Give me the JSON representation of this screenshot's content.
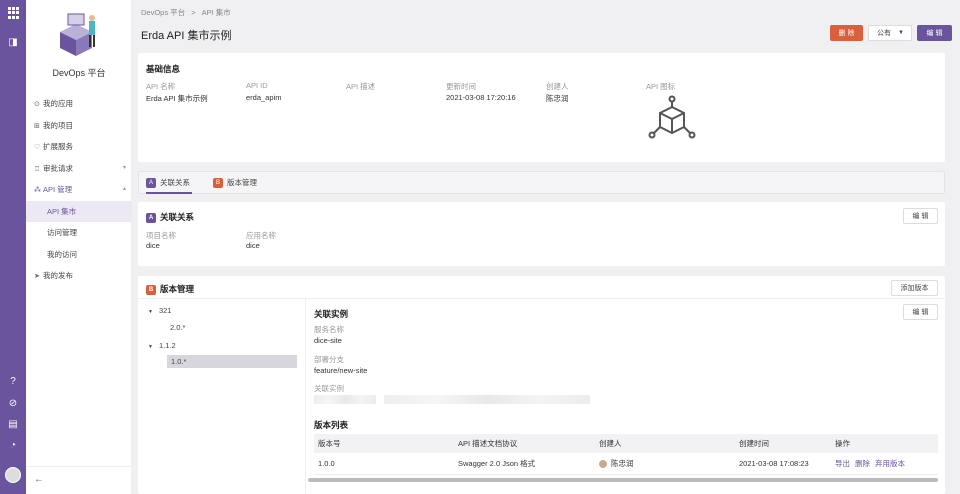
{
  "sidebar": {
    "brand": "DevOps 平台",
    "items": [
      {
        "label": "我的应用",
        "icon": "app-icon"
      },
      {
        "label": "我的项目",
        "icon": "project-icon"
      },
      {
        "label": "扩展服务",
        "icon": "heart-icon"
      },
      {
        "label": "审批请求",
        "icon": "approval-icon"
      },
      {
        "label": "API 管理",
        "icon": "api-icon"
      },
      {
        "label": "API 集市"
      },
      {
        "label": "访问管理"
      },
      {
        "label": "我的访问"
      },
      {
        "label": "我的发布",
        "icon": "send-icon"
      }
    ]
  },
  "breadcrumb": {
    "root": "DevOps 平台",
    "sep": ">",
    "current": "API 集市"
  },
  "page": {
    "title": "Erda API 集市示例"
  },
  "actions": {
    "delete": "删 除",
    "visibility": "公有",
    "edit": "编 辑"
  },
  "basic": {
    "heading": "基础信息",
    "fields": [
      {
        "label": "API 名称",
        "value": "Erda API 集市示例"
      },
      {
        "label": "API ID",
        "value": "erda_apim"
      },
      {
        "label": "API 描述",
        "value": ""
      },
      {
        "label": "更新时间",
        "value": "2021-03-08 17:20:16"
      },
      {
        "label": "创建人",
        "value": "陈忠润"
      },
      {
        "label": "API 图标",
        "value": ""
      }
    ]
  },
  "tabs": [
    {
      "label": "关联关系"
    },
    {
      "label": "版本管理"
    }
  ],
  "relation": {
    "heading": "关联关系",
    "edit": "编 辑",
    "project_label": "项目名称",
    "project_value": "dice",
    "app_label": "应用名称",
    "app_value": "dice"
  },
  "version": {
    "heading": "版本管理",
    "add": "添加版本",
    "tree": [
      {
        "label": "321",
        "children": [
          "2.0.*"
        ]
      },
      {
        "label": "1.1.2",
        "children": [
          "1.0.*"
        ]
      }
    ],
    "instance_heading": "关联实例",
    "edit": "编 辑",
    "service_label": "服务名称",
    "service_value": "dice-site",
    "branch_label": "部署分支",
    "branch_value": "feature/new-site",
    "instance_label": "关联实例",
    "list_heading": "版本列表",
    "columns": [
      "版本号",
      "API 描述文档协议",
      "创建人",
      "创建时间",
      "操作"
    ],
    "rows": [
      {
        "version": "1.0.0",
        "protocol": "Swagger 2.0 Json 格式",
        "creator": "陈忠润",
        "time": "2021-03-08 17:08:23",
        "ops": [
          "导出",
          "删除",
          "弃用版本"
        ]
      }
    ]
  }
}
